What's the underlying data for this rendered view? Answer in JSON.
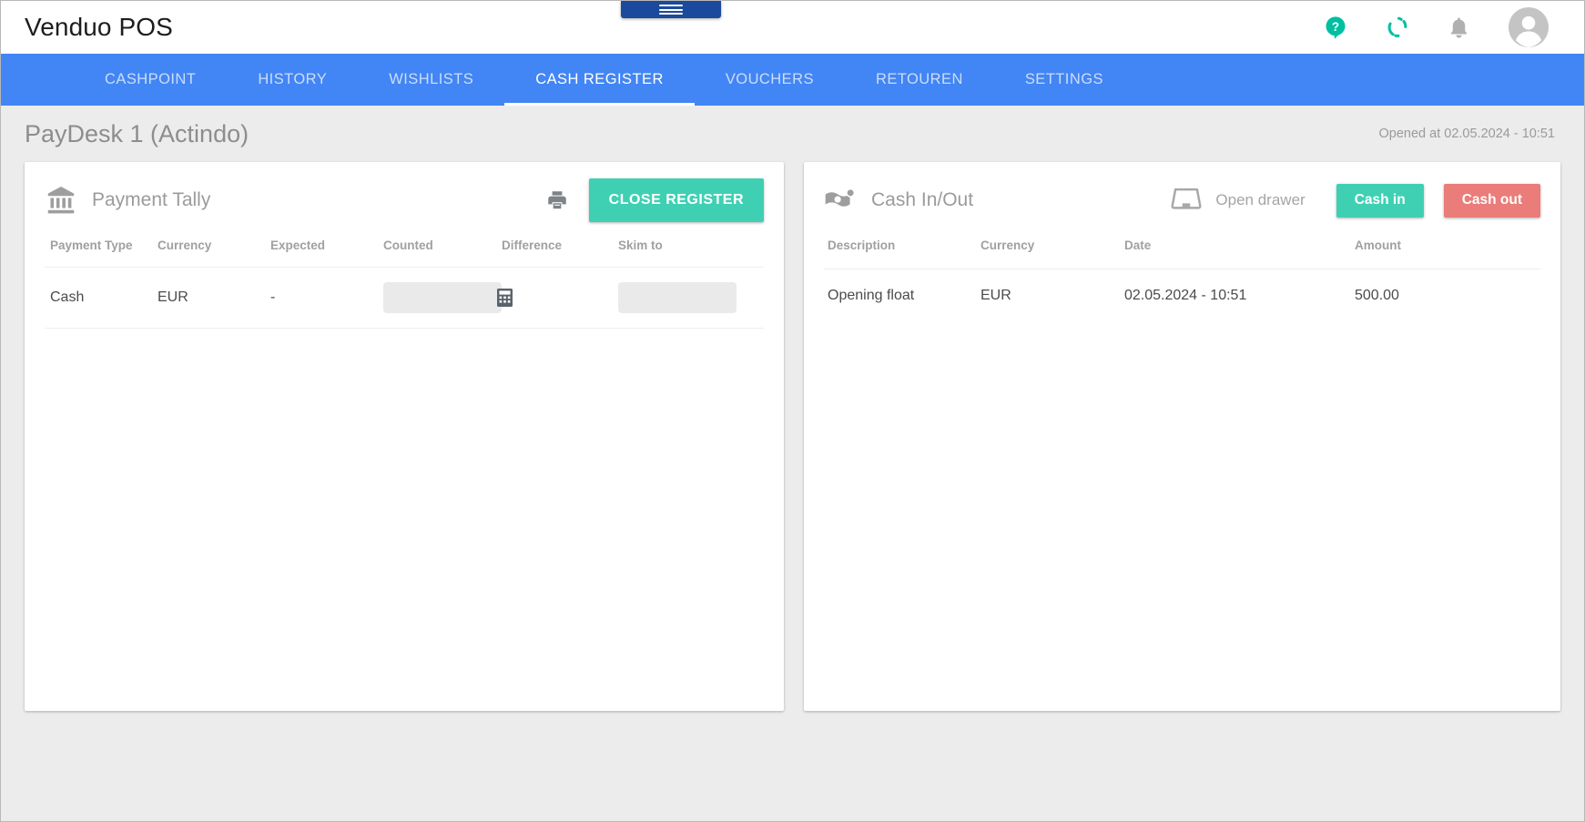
{
  "app": {
    "brand": "Venduo POS",
    "hamburger_icon": "hamburger-menu-icon",
    "accent_teal": "#3fd0b4",
    "accent_red": "#ea7c79",
    "nav_blue": "#4285f4"
  },
  "topbar": {
    "icons": [
      {
        "name": "help-icon",
        "label": "Help"
      },
      {
        "name": "sync-icon",
        "label": "Sync"
      },
      {
        "name": "notifications-bell-icon",
        "label": "Notifications"
      },
      {
        "name": "user-avatar-icon",
        "label": "Account"
      }
    ]
  },
  "nav": {
    "tabs": [
      {
        "label": "CASHPOINT",
        "active": false
      },
      {
        "label": "HISTORY",
        "active": false
      },
      {
        "label": "WISHLISTS",
        "active": false
      },
      {
        "label": "CASH REGISTER",
        "active": true
      },
      {
        "label": "VOUCHERS",
        "active": false
      },
      {
        "label": "RETOUREN",
        "active": false
      },
      {
        "label": "SETTINGS",
        "active": false
      }
    ]
  },
  "page": {
    "title": "PayDesk 1 (Actindo)",
    "opened_at": "Opened at 02.05.2024 - 10:51"
  },
  "payment_tally": {
    "icon": "bank-icon",
    "title": "Payment Tally",
    "print_icon": "printer-icon",
    "close_register_label": "CLOSE REGISTER",
    "columns": [
      "Payment Type",
      "Currency",
      "Expected",
      "Counted",
      "Difference",
      "Skim to"
    ],
    "rows": [
      {
        "payment_type": "Cash",
        "currency": "EUR",
        "expected": "-",
        "counted_value": "",
        "counted_placeholder": "",
        "calculator_icon": "calculator-icon",
        "difference": "",
        "skim_to_value": "",
        "skim_to_placeholder": ""
      }
    ]
  },
  "cash_in_out": {
    "icon": "money-bill-icon",
    "title": "Cash In/Out",
    "open_drawer_icon": "cash-drawer-icon",
    "open_drawer_label": "Open drawer",
    "cash_in_label": "Cash in",
    "cash_out_label": "Cash out",
    "columns": [
      "Description",
      "Currency",
      "Date",
      "Amount"
    ],
    "rows": [
      {
        "description": "Opening float",
        "currency": "EUR",
        "date": "02.05.2024 - 10:51",
        "amount": "500.00"
      }
    ]
  }
}
